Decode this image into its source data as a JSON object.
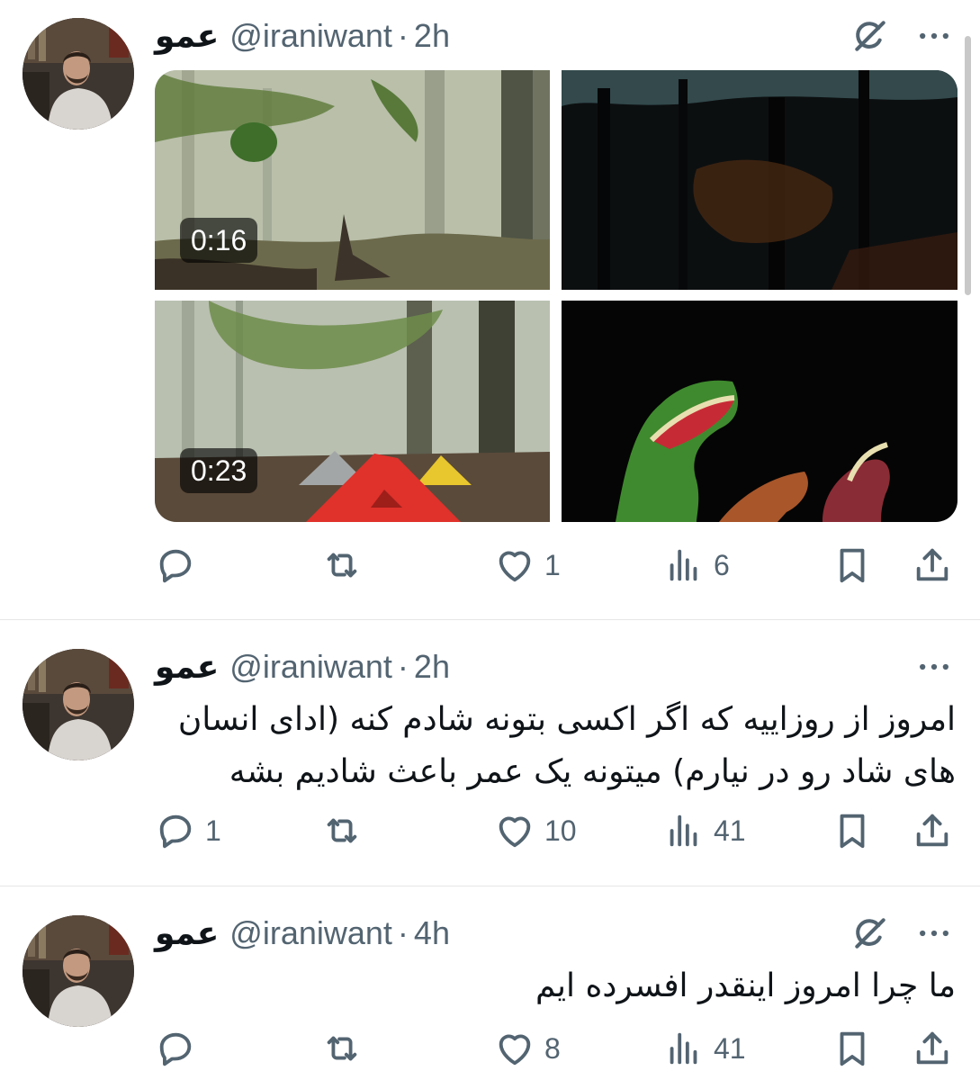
{
  "tweets": [
    {
      "name": "عمو",
      "handle": "@iraniwant",
      "separator": "·",
      "time": "2h",
      "has_grok_icon": true,
      "text": "",
      "media": [
        {
          "kind": "video",
          "duration": "0:16",
          "scene": "foggy forest"
        },
        {
          "kind": "image",
          "scene": "dark forest"
        },
        {
          "kind": "video",
          "duration": "0:23",
          "scene": "forest with tents"
        },
        {
          "kind": "image",
          "scene": "dinosaur hand puppets"
        }
      ],
      "actions": {
        "replies": "",
        "retweets": "",
        "likes": "1",
        "views": "6"
      }
    },
    {
      "name": "عمو",
      "handle": "@iraniwant",
      "separator": "·",
      "time": "2h",
      "has_grok_icon": false,
      "text_lines": [
        "امروز از روزاییه که اگر اکسی بتونه شادم کنه (ادای انسان",
        "های شاد رو در نیارم) میتونه یک عمر باعث شادیم بشه"
      ],
      "actions": {
        "replies": "1",
        "retweets": "",
        "likes": "10",
        "views": "41"
      }
    },
    {
      "name": "عمو",
      "handle": "@iraniwant",
      "separator": "·",
      "time": "4h",
      "has_grok_icon": true,
      "text_lines": [
        "ما چرا امروز اینقدر افسرده ایم"
      ],
      "actions": {
        "replies": "",
        "retweets": "",
        "likes": "8",
        "views": "41"
      }
    }
  ],
  "icons": {
    "reply": "speech-bubble-icon",
    "retweet": "retweet-arrows-icon",
    "like": "heart-icon",
    "views": "bar-chart-icon",
    "bookmark": "bookmark-icon",
    "share": "share-upload-icon",
    "grok": "grok-slash-icon",
    "more": "ellipsis-icon"
  },
  "colors": {
    "text": "#0f1419",
    "secondary": "#536471",
    "divider": "#e6e6e6"
  }
}
